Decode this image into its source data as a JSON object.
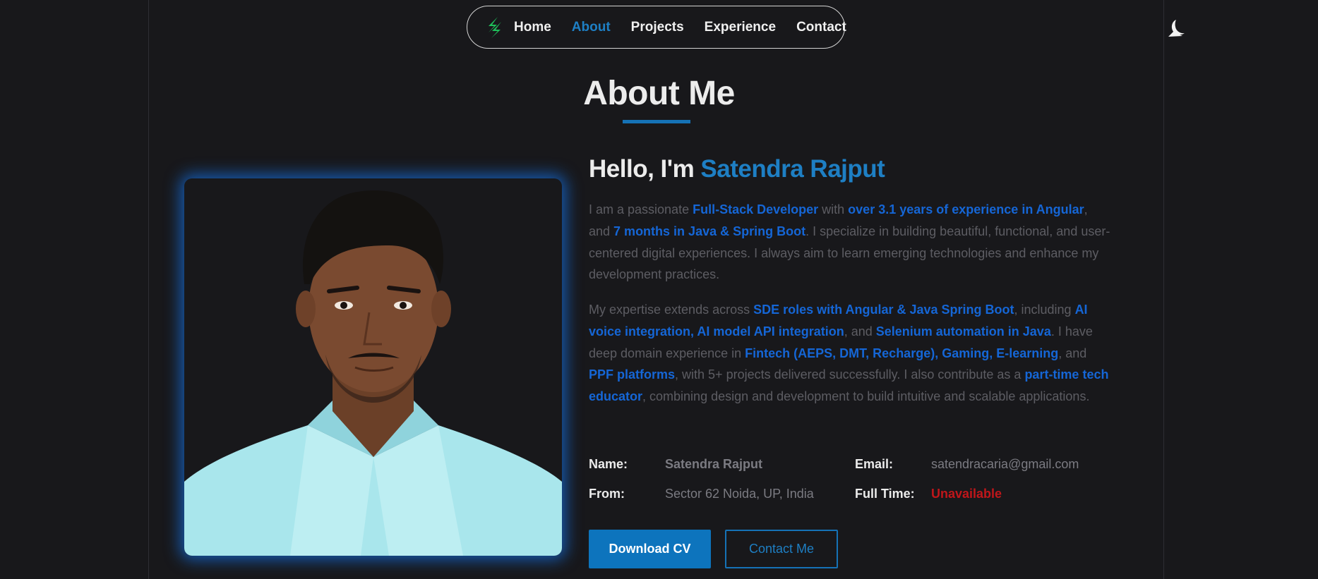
{
  "nav": {
    "logo_icon": "bolt-logo-icon",
    "items": [
      {
        "label": "Home",
        "active": false
      },
      {
        "label": "About",
        "active": true
      },
      {
        "label": "Projects",
        "active": false
      },
      {
        "label": "Experience",
        "active": false
      },
      {
        "label": "Contact",
        "active": false
      }
    ],
    "theme_toggle_icon": "moon-icon"
  },
  "section": {
    "title": "About Me"
  },
  "hero": {
    "greeting": "Hello, I'm",
    "name": "Satendra Rajput"
  },
  "bio": {
    "p1": [
      {
        "t": "I am a passionate "
      },
      {
        "t": "Full-Stack Developer",
        "b": true
      },
      {
        "t": " with "
      },
      {
        "t": "over 3.1 years of experience in Angular",
        "b": true
      },
      {
        "t": ", and "
      },
      {
        "t": "7 months in Java & Spring Boot",
        "b": true
      },
      {
        "t": ". I specialize in building beautiful, functional, and user-centered digital experiences. I always aim to learn emerging technologies and enhance my development practices."
      }
    ],
    "p2": [
      {
        "t": "My expertise extends across "
      },
      {
        "t": "SDE roles with Angular & Java Spring Boot",
        "b": true
      },
      {
        "t": ", including "
      },
      {
        "t": "AI voice integration, AI model API integration",
        "b": true
      },
      {
        "t": ", and "
      },
      {
        "t": "Selenium automation in Java",
        "b": true
      },
      {
        "t": ". I have deep domain experience in "
      },
      {
        "t": "Fintech (AEPS, DMT, Recharge), Gaming, E-learning",
        "b": true
      },
      {
        "t": ", and "
      },
      {
        "t": "PPF platforms",
        "b": true
      },
      {
        "t": ", with 5+ projects delivered successfully. I also contribute as a "
      },
      {
        "t": "part-time tech educator",
        "b": true
      },
      {
        "t": ", combining design and development to build intuitive and scalable applications."
      }
    ]
  },
  "info": {
    "name_label": "Name:",
    "name_value": "Satendra Rajput",
    "from_label": "From:",
    "from_value": "Sector 62 Noida, UP, India",
    "email_label": "Email:",
    "email_value": "satendracaria@gmail.com",
    "fulltime_label": "Full Time:",
    "fulltime_value": "Unavailable"
  },
  "buttons": {
    "download_cv": "Download CV",
    "contact_me": "Contact Me"
  },
  "colors": {
    "accent": "#1e7fc4",
    "highlight": "#1566d6",
    "background": "#18181b",
    "unavailable": "#c0161a"
  }
}
